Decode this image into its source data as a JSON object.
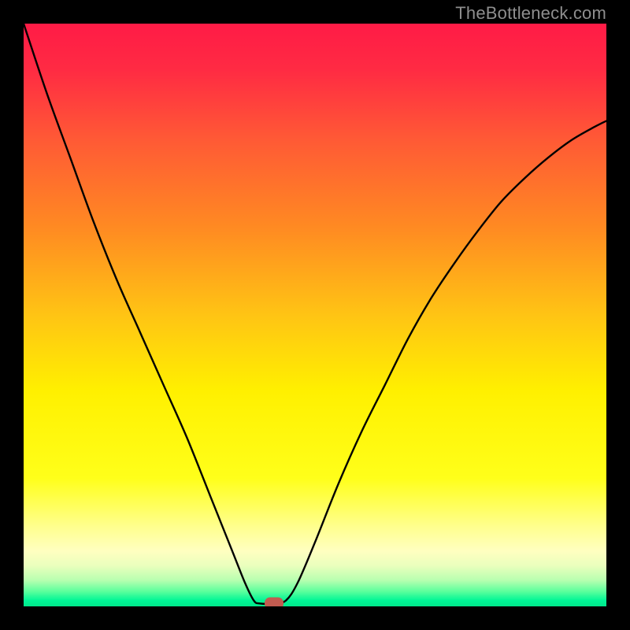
{
  "watermark": "TheBottleneck.com",
  "chart_data": {
    "type": "line",
    "title": "",
    "xlabel": "",
    "ylabel": "",
    "xlim": [
      0,
      1
    ],
    "ylim": [
      0,
      1
    ],
    "gradient_stops": [
      {
        "pos": 0.0,
        "color": "#ff1b46"
      },
      {
        "pos": 0.08,
        "color": "#ff2b43"
      },
      {
        "pos": 0.2,
        "color": "#ff5a35"
      },
      {
        "pos": 0.35,
        "color": "#ff8a22"
      },
      {
        "pos": 0.5,
        "color": "#ffc414"
      },
      {
        "pos": 0.63,
        "color": "#fff000"
      },
      {
        "pos": 0.78,
        "color": "#ffff1a"
      },
      {
        "pos": 0.86,
        "color": "#ffff8a"
      },
      {
        "pos": 0.905,
        "color": "#ffffc0"
      },
      {
        "pos": 0.93,
        "color": "#eaffbd"
      },
      {
        "pos": 0.955,
        "color": "#b8ffb0"
      },
      {
        "pos": 0.975,
        "color": "#58ff9c"
      },
      {
        "pos": 0.99,
        "color": "#00f596"
      },
      {
        "pos": 1.0,
        "color": "#00e88b"
      }
    ],
    "series": [
      {
        "name": "bottleneck-curve",
        "x": [
          0.0,
          0.04,
          0.08,
          0.12,
          0.16,
          0.2,
          0.24,
          0.28,
          0.32,
          0.34,
          0.36,
          0.38,
          0.395,
          0.405,
          0.43,
          0.45,
          0.47,
          0.5,
          0.54,
          0.58,
          0.62,
          0.66,
          0.7,
          0.74,
          0.78,
          0.82,
          0.86,
          0.9,
          0.94,
          0.98,
          1.0
        ],
        "y": [
          1.0,
          0.88,
          0.77,
          0.66,
          0.56,
          0.47,
          0.38,
          0.29,
          0.19,
          0.14,
          0.09,
          0.04,
          0.01,
          0.005,
          0.005,
          0.01,
          0.04,
          0.11,
          0.21,
          0.3,
          0.38,
          0.46,
          0.53,
          0.59,
          0.645,
          0.695,
          0.735,
          0.77,
          0.8,
          0.823,
          0.833
        ]
      }
    ],
    "flat_segment": {
      "x0": 0.395,
      "x1": 0.43,
      "y": 0.005
    },
    "marker": {
      "x": 0.43,
      "y": 0.005,
      "color": "#c25b50"
    }
  }
}
